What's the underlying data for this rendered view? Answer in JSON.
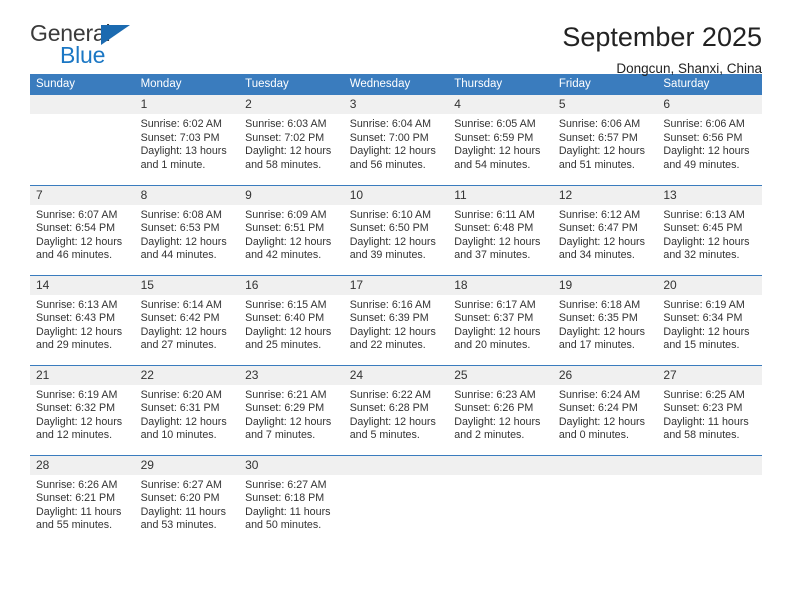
{
  "logo": {
    "word1": "General",
    "word2": "Blue",
    "triangle_color": "#1b6ab0",
    "blue_color": "#1b77c4"
  },
  "header": {
    "title": "September 2025",
    "subtitle": "Dongcun, Shanxi, China"
  },
  "theme": {
    "header_blue": "#3a7cbe",
    "daynum_gray": "#f0f0f0",
    "text": "#333333"
  },
  "calendar": {
    "weekday_headers": [
      "Sunday",
      "Monday",
      "Tuesday",
      "Wednesday",
      "Thursday",
      "Friday",
      "Saturday"
    ],
    "weeks": [
      [
        {
          "day": "",
          "sunrise": "",
          "sunset": "",
          "daylight1": "",
          "daylight2": ""
        },
        {
          "day": "1",
          "sunrise": "Sunrise: 6:02 AM",
          "sunset": "Sunset: 7:03 PM",
          "daylight1": "Daylight: 13 hours",
          "daylight2": "and 1 minute."
        },
        {
          "day": "2",
          "sunrise": "Sunrise: 6:03 AM",
          "sunset": "Sunset: 7:02 PM",
          "daylight1": "Daylight: 12 hours",
          "daylight2": "and 58 minutes."
        },
        {
          "day": "3",
          "sunrise": "Sunrise: 6:04 AM",
          "sunset": "Sunset: 7:00 PM",
          "daylight1": "Daylight: 12 hours",
          "daylight2": "and 56 minutes."
        },
        {
          "day": "4",
          "sunrise": "Sunrise: 6:05 AM",
          "sunset": "Sunset: 6:59 PM",
          "daylight1": "Daylight: 12 hours",
          "daylight2": "and 54 minutes."
        },
        {
          "day": "5",
          "sunrise": "Sunrise: 6:06 AM",
          "sunset": "Sunset: 6:57 PM",
          "daylight1": "Daylight: 12 hours",
          "daylight2": "and 51 minutes."
        },
        {
          "day": "6",
          "sunrise": "Sunrise: 6:06 AM",
          "sunset": "Sunset: 6:56 PM",
          "daylight1": "Daylight: 12 hours",
          "daylight2": "and 49 minutes."
        }
      ],
      [
        {
          "day": "7",
          "sunrise": "Sunrise: 6:07 AM",
          "sunset": "Sunset: 6:54 PM",
          "daylight1": "Daylight: 12 hours",
          "daylight2": "and 46 minutes."
        },
        {
          "day": "8",
          "sunrise": "Sunrise: 6:08 AM",
          "sunset": "Sunset: 6:53 PM",
          "daylight1": "Daylight: 12 hours",
          "daylight2": "and 44 minutes."
        },
        {
          "day": "9",
          "sunrise": "Sunrise: 6:09 AM",
          "sunset": "Sunset: 6:51 PM",
          "daylight1": "Daylight: 12 hours",
          "daylight2": "and 42 minutes."
        },
        {
          "day": "10",
          "sunrise": "Sunrise: 6:10 AM",
          "sunset": "Sunset: 6:50 PM",
          "daylight1": "Daylight: 12 hours",
          "daylight2": "and 39 minutes."
        },
        {
          "day": "11",
          "sunrise": "Sunrise: 6:11 AM",
          "sunset": "Sunset: 6:48 PM",
          "daylight1": "Daylight: 12 hours",
          "daylight2": "and 37 minutes."
        },
        {
          "day": "12",
          "sunrise": "Sunrise: 6:12 AM",
          "sunset": "Sunset: 6:47 PM",
          "daylight1": "Daylight: 12 hours",
          "daylight2": "and 34 minutes."
        },
        {
          "day": "13",
          "sunrise": "Sunrise: 6:13 AM",
          "sunset": "Sunset: 6:45 PM",
          "daylight1": "Daylight: 12 hours",
          "daylight2": "and 32 minutes."
        }
      ],
      [
        {
          "day": "14",
          "sunrise": "Sunrise: 6:13 AM",
          "sunset": "Sunset: 6:43 PM",
          "daylight1": "Daylight: 12 hours",
          "daylight2": "and 29 minutes."
        },
        {
          "day": "15",
          "sunrise": "Sunrise: 6:14 AM",
          "sunset": "Sunset: 6:42 PM",
          "daylight1": "Daylight: 12 hours",
          "daylight2": "and 27 minutes."
        },
        {
          "day": "16",
          "sunrise": "Sunrise: 6:15 AM",
          "sunset": "Sunset: 6:40 PM",
          "daylight1": "Daylight: 12 hours",
          "daylight2": "and 25 minutes."
        },
        {
          "day": "17",
          "sunrise": "Sunrise: 6:16 AM",
          "sunset": "Sunset: 6:39 PM",
          "daylight1": "Daylight: 12 hours",
          "daylight2": "and 22 minutes."
        },
        {
          "day": "18",
          "sunrise": "Sunrise: 6:17 AM",
          "sunset": "Sunset: 6:37 PM",
          "daylight1": "Daylight: 12 hours",
          "daylight2": "and 20 minutes."
        },
        {
          "day": "19",
          "sunrise": "Sunrise: 6:18 AM",
          "sunset": "Sunset: 6:35 PM",
          "daylight1": "Daylight: 12 hours",
          "daylight2": "and 17 minutes."
        },
        {
          "day": "20",
          "sunrise": "Sunrise: 6:19 AM",
          "sunset": "Sunset: 6:34 PM",
          "daylight1": "Daylight: 12 hours",
          "daylight2": "and 15 minutes."
        }
      ],
      [
        {
          "day": "21",
          "sunrise": "Sunrise: 6:19 AM",
          "sunset": "Sunset: 6:32 PM",
          "daylight1": "Daylight: 12 hours",
          "daylight2": "and 12 minutes."
        },
        {
          "day": "22",
          "sunrise": "Sunrise: 6:20 AM",
          "sunset": "Sunset: 6:31 PM",
          "daylight1": "Daylight: 12 hours",
          "daylight2": "and 10 minutes."
        },
        {
          "day": "23",
          "sunrise": "Sunrise: 6:21 AM",
          "sunset": "Sunset: 6:29 PM",
          "daylight1": "Daylight: 12 hours",
          "daylight2": "and 7 minutes."
        },
        {
          "day": "24",
          "sunrise": "Sunrise: 6:22 AM",
          "sunset": "Sunset: 6:28 PM",
          "daylight1": "Daylight: 12 hours",
          "daylight2": "and 5 minutes."
        },
        {
          "day": "25",
          "sunrise": "Sunrise: 6:23 AM",
          "sunset": "Sunset: 6:26 PM",
          "daylight1": "Daylight: 12 hours",
          "daylight2": "and 2 minutes."
        },
        {
          "day": "26",
          "sunrise": "Sunrise: 6:24 AM",
          "sunset": "Sunset: 6:24 PM",
          "daylight1": "Daylight: 12 hours",
          "daylight2": "and 0 minutes."
        },
        {
          "day": "27",
          "sunrise": "Sunrise: 6:25 AM",
          "sunset": "Sunset: 6:23 PM",
          "daylight1": "Daylight: 11 hours",
          "daylight2": "and 58 minutes."
        }
      ],
      [
        {
          "day": "28",
          "sunrise": "Sunrise: 6:26 AM",
          "sunset": "Sunset: 6:21 PM",
          "daylight1": "Daylight: 11 hours",
          "daylight2": "and 55 minutes."
        },
        {
          "day": "29",
          "sunrise": "Sunrise: 6:27 AM",
          "sunset": "Sunset: 6:20 PM",
          "daylight1": "Daylight: 11 hours",
          "daylight2": "and 53 minutes."
        },
        {
          "day": "30",
          "sunrise": "Sunrise: 6:27 AM",
          "sunset": "Sunset: 6:18 PM",
          "daylight1": "Daylight: 11 hours",
          "daylight2": "and 50 minutes."
        },
        {
          "day": "",
          "sunrise": "",
          "sunset": "",
          "daylight1": "",
          "daylight2": ""
        },
        {
          "day": "",
          "sunrise": "",
          "sunset": "",
          "daylight1": "",
          "daylight2": ""
        },
        {
          "day": "",
          "sunrise": "",
          "sunset": "",
          "daylight1": "",
          "daylight2": ""
        },
        {
          "day": "",
          "sunrise": "",
          "sunset": "",
          "daylight1": "",
          "daylight2": ""
        }
      ]
    ]
  }
}
